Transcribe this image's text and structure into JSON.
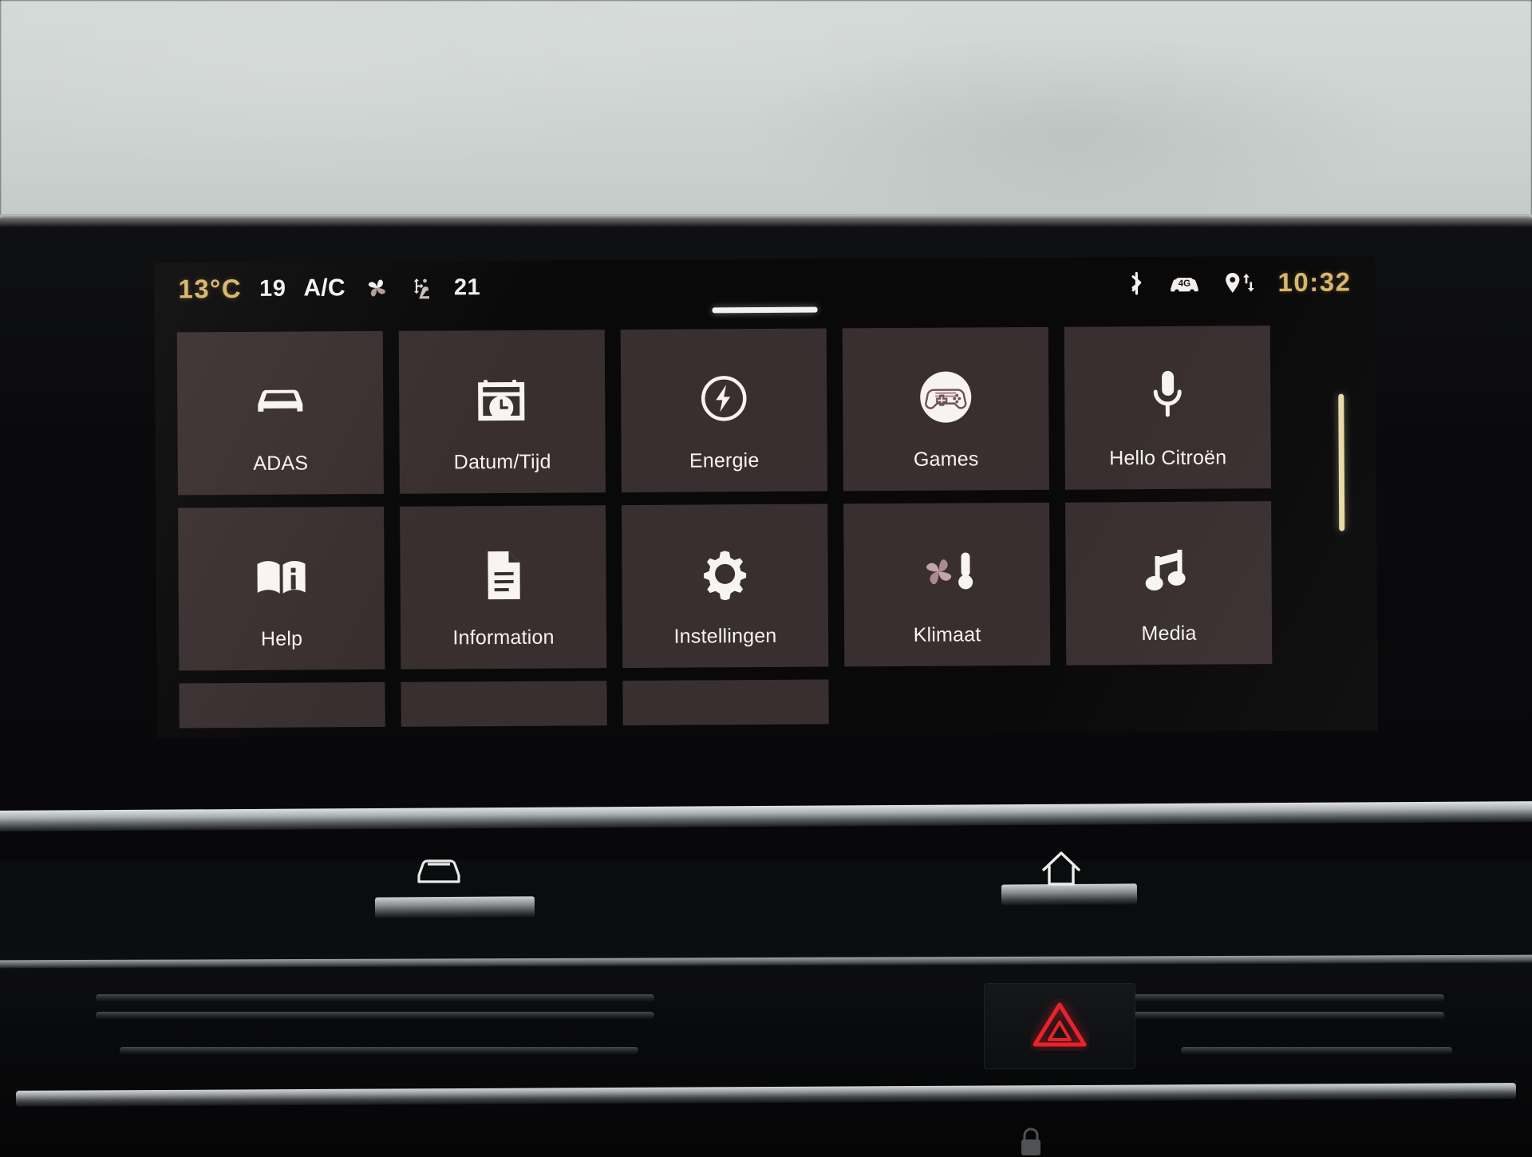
{
  "device": {
    "name": "Citroen infotainment touchscreen",
    "screen_background": "#090909",
    "tile_background": "#3a2f30",
    "accent_gold": "#d9b56a",
    "text_color": "#f6f3f2"
  },
  "statusbar": {
    "outside_temperature": "13°C",
    "driver_temperature": "19",
    "ac_label": "A/C",
    "fan_icon": "fan-icon",
    "airflow_icon": "airflow-direction-icon",
    "passenger_temperature": "21",
    "bluetooth_icon": "bluetooth-icon",
    "network_badge": "4G",
    "network_icon": "car-4g-icon",
    "location_icon": "location-pin-transfer-icon",
    "clock": "10:32"
  },
  "page_indicator": {
    "current_page": 1,
    "total_pages": 1
  },
  "scrollbar": {
    "position_percent": 0,
    "thumb_height_percent": 41
  },
  "grid": {
    "columns": 5,
    "tiles": [
      {
        "label": "ADAS",
        "icon": "car-front-icon",
        "icon_style": "solid-white"
      },
      {
        "label": "Datum/Tijd",
        "icon": "calendar-clock-icon",
        "icon_style": "solid-white"
      },
      {
        "label": "Energie",
        "icon": "energy-bolt-icon",
        "icon_style": "outline-white"
      },
      {
        "label": "Games",
        "icon": "gamepad-icon",
        "icon_style": "filled-circle"
      },
      {
        "label": "Hello Citroën",
        "icon": "microphone-icon",
        "icon_style": "solid-white"
      },
      {
        "label": "Help",
        "icon": "book-info-icon",
        "icon_style": "solid-white"
      },
      {
        "label": "Information",
        "icon": "document-icon",
        "icon_style": "solid-white"
      },
      {
        "label": "Instellingen",
        "icon": "gear-icon",
        "icon_style": "solid-white"
      },
      {
        "label": "Klimaat",
        "icon": "fan-thermometer-icon",
        "icon_style": "mauve"
      },
      {
        "label": "Media",
        "icon": "music-note-icon",
        "icon_style": "solid-white"
      }
    ],
    "partial_row_tile_count": 3
  },
  "hardware_buttons": [
    {
      "name": "vehicle-button",
      "icon": "car-outline-icon"
    },
    {
      "name": "home-button",
      "icon": "home-icon"
    }
  ],
  "console": {
    "hazard_button_icon": "hazard-triangle-icon",
    "hazard_button_color": "#e01b24",
    "lock_icon": "lock-icon"
  }
}
